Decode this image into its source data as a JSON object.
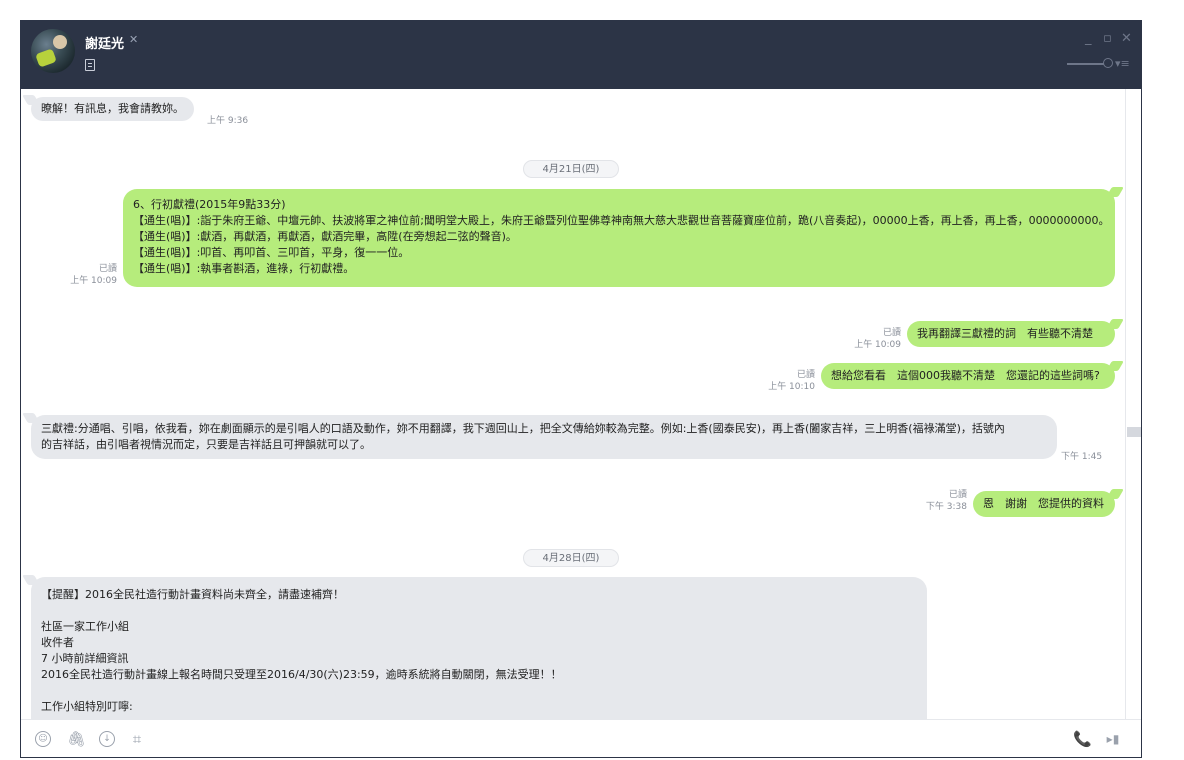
{
  "header": {
    "contact_name": "謝廷光",
    "mute_icon": "🔇",
    "minimize": "_",
    "maximize": "▫",
    "close": "✕",
    "menu": "▾≡"
  },
  "messages": [
    {
      "id": "m1",
      "type": "in",
      "text": "暸解！有訊息，我會請教妳。",
      "time": "上午 9:36"
    },
    {
      "id": "d1",
      "type": "date",
      "text": "4月21日(四)"
    },
    {
      "id": "m2",
      "type": "out",
      "lines": [
        "6、行初獻禮(2015年9點33分)",
        "【通生(唱)】:詣于朱府王爺、中壇元帥、扶波將軍之神位前;聞明堂大殿上，朱府王爺暨列位聖佛尊神南無大慈大悲觀世音菩薩寶座位前，跪(八音奏起)，00000上香，再上香，再上香，0000000000。",
        "【通生(唱)】:獻酒，再獻酒，再獻酒，獻酒完畢，高陞(在旁想起二弦的聲音)。",
        "【通生(唱)】:叩首、再叩首、三叩首，平身，復一一位。",
        "【通生(唱)】:執事者斟酒，進祿，行初獻禮。"
      ],
      "read": "已讀",
      "time": "上午 10:09"
    },
    {
      "id": "m3",
      "type": "out",
      "text": "我再翻譯三獻禮的詞　有些聽不清楚",
      "read": "已讀",
      "time": "上午 10:09"
    },
    {
      "id": "m4",
      "type": "out",
      "text": "想給您看看　這個000我聽不清楚　您還記的這些詞嗎?",
      "read": "已讀",
      "time": "上午 10:10"
    },
    {
      "id": "m5",
      "type": "in",
      "lines": [
        "三獻禮:分通唱、引唱，依我看，妳在劇面顯示的是引唱人的口語及動作，妳不用翻譯，我下週回山上，把全文傳給妳較為完整。例如:上香(國泰民安)，再上香(闔家吉祥，三上明香(福祿滿堂)，括號內",
        "的吉祥話，由引唱者視情況而定，只要是吉祥話且可押韻就可以了。"
      ],
      "time": "下午 1:45"
    },
    {
      "id": "m6",
      "type": "out",
      "text": "恩　謝謝　您提供的資料",
      "read": "已讀",
      "time": "下午 3:38"
    },
    {
      "id": "d2",
      "type": "date",
      "text": "4月28日(四)"
    },
    {
      "id": "m7",
      "type": "in",
      "lines": [
        "【提醒】2016全民社造行動計畫資料尚未齊全，請盡速補齊！",
        "",
        "社區一家工作小組",
        "收件者",
        "7 小時前詳細資訊",
        "2016全民社造行動計畫線上報名時間只受理至2016/4/30(六)23:59，逾時系統將自動關閉，無法受理！！",
        "",
        "工作小組特別叮嚀:"
      ]
    }
  ],
  "toolbar": {
    "emoji": "☺",
    "attach": "🖇",
    "download": "↓",
    "crop": "⌗",
    "call": "📞",
    "send": "▸▮"
  }
}
